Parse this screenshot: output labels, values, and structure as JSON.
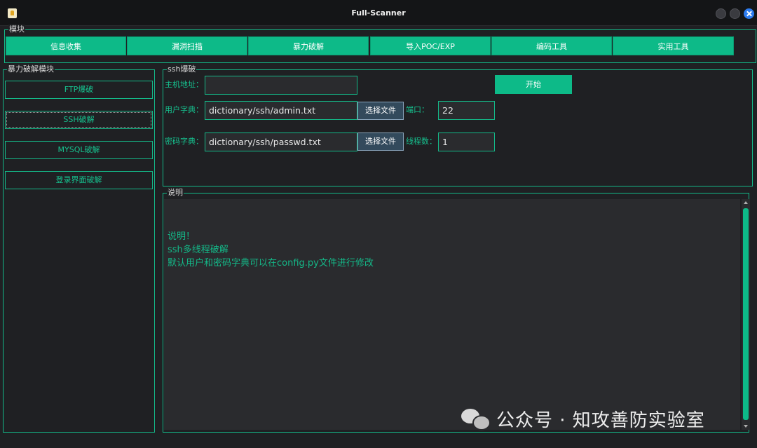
{
  "window": {
    "title": "Full-Scanner"
  },
  "modules": {
    "group_title": "模块",
    "tabs": [
      {
        "label": "信息收集"
      },
      {
        "label": "漏洞扫描"
      },
      {
        "label": "暴力破解"
      },
      {
        "label": "导入POC/EXP"
      },
      {
        "label": "编码工具"
      },
      {
        "label": "实用工具"
      }
    ]
  },
  "brute_modules": {
    "group_title": "暴力破解模块",
    "items": [
      {
        "label": "FTP爆破"
      },
      {
        "label": "SSH破解"
      },
      {
        "label": "MYSQL破解"
      },
      {
        "label": "登录界面破解"
      }
    ],
    "active_item": "SSH破解"
  },
  "ssh_panel": {
    "group_title": "ssh爆破",
    "host_label": "主机地址：",
    "host_value": "",
    "start_label": "开始",
    "user_dict_label": "用户字典：",
    "user_dict_value": "dictionary/ssh/admin.txt",
    "choose_file_label": "选择文件",
    "port_label": "端口：",
    "port_value": "22",
    "pass_dict_label": "密码字典：",
    "pass_dict_value": "dictionary/ssh/passwd.txt",
    "threads_label": "线程数：",
    "threads_value": "1"
  },
  "description": {
    "group_title": "说明",
    "lines": [
      "说明！",
      "ssh多线程破解",
      "默认用户和密码字典可以在config.py文件进行修改"
    ]
  },
  "watermark": {
    "text": "公众号 · 知攻善防实验室"
  },
  "colors": {
    "accent": "#0dba88",
    "background": "#1f2023",
    "input_bg": "#2a2b2e",
    "file_button": "#334a5c"
  }
}
